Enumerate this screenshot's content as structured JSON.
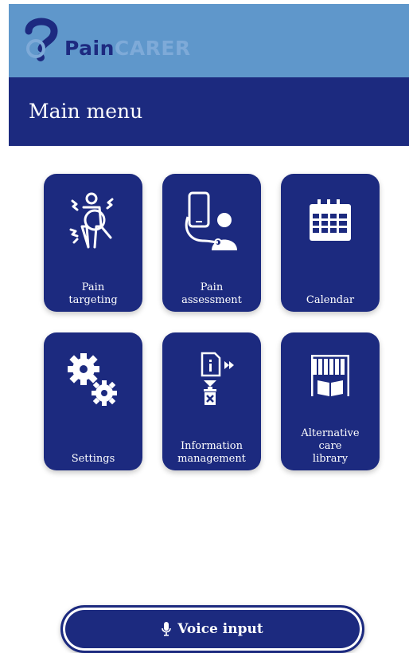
{
  "app": {
    "logo_word_1": "Pain",
    "logo_word_2": "CARER",
    "logo_icon": "paincarer-logo-icon"
  },
  "header": {
    "title": "Main menu"
  },
  "menu": {
    "items": [
      {
        "label": "Pain\ntargeting",
        "icon": "pain-targeting-icon"
      },
      {
        "label": "Pain\nassessment",
        "icon": "pain-assessment-icon"
      },
      {
        "label": "Calendar",
        "icon": "calendar-icon"
      },
      {
        "label": "Settings",
        "icon": "settings-gears-icon"
      },
      {
        "label": "Information\nmanagement",
        "icon": "information-management-icon"
      },
      {
        "label": "Alternative\ncare\nlibrary",
        "icon": "library-icon"
      }
    ]
  },
  "voice": {
    "label": "Voice input",
    "icon": "microphone-icon"
  },
  "colors": {
    "brand_dark": "#1c2a7f",
    "brand_light": "#5f97cb",
    "background": "#ffffff"
  }
}
